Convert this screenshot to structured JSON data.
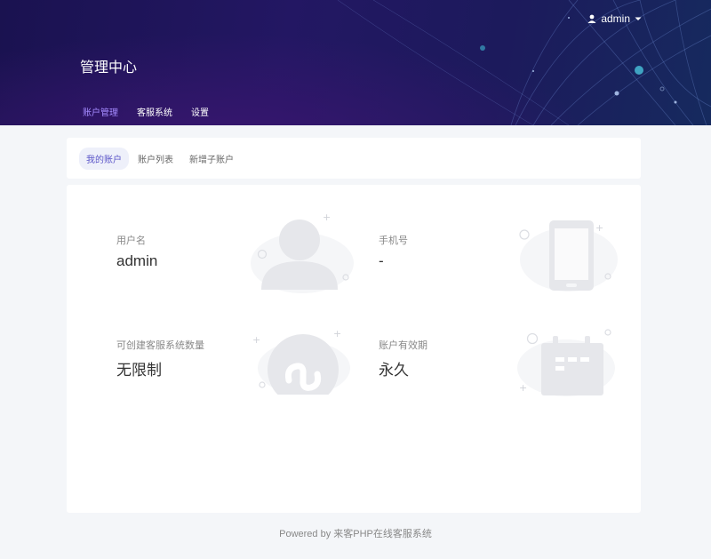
{
  "header": {
    "user_name": "admin",
    "title": "管理中心",
    "nav": [
      {
        "label": "账户管理",
        "active": true
      },
      {
        "label": "客服系统",
        "active": false
      },
      {
        "label": "设置",
        "active": false
      }
    ]
  },
  "subtabs": [
    {
      "label": "我的账户",
      "active": true
    },
    {
      "label": "账户列表",
      "active": false
    },
    {
      "label": "新增子账户",
      "active": false
    }
  ],
  "account": {
    "username_label": "用户名",
    "username_value": "admin",
    "phone_label": "手机号",
    "phone_value": "-",
    "quota_label": "可创建客服系统数量",
    "quota_value": "无限制",
    "validity_label": "账户有效期",
    "validity_value": "永久"
  },
  "footer": "Powered by 来客PHP在线客服系统",
  "colors": {
    "accent": "#7d5cf5",
    "header_bg": "#1f1659",
    "deco_gray": "#e9ebef"
  },
  "icons": [
    "user-icon",
    "caret-down-icon",
    "avatar-illustration-icon",
    "phone-illustration-icon",
    "miniprogram-illustration-icon",
    "calendar-illustration-icon"
  ]
}
